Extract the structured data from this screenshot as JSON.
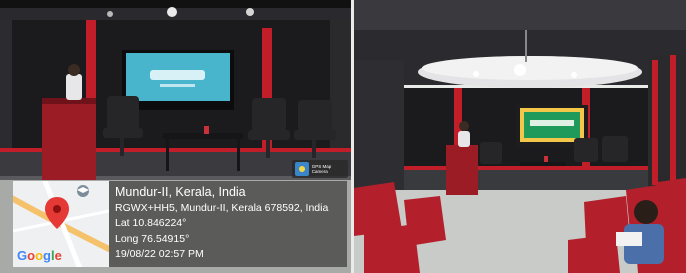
{
  "geotag": {
    "place": "Mundur-II, Kerala, India",
    "address": "RGWX+HH5, Mundur-II, Kerala 678592, India",
    "latitude": "Lat 10.846224°",
    "longitude": "Long 76.54915°",
    "timestamp": "19/08/22 02:57 PM"
  },
  "map": {
    "brand": "Google",
    "brand_colors": [
      "#4285F4",
      "#EA4335",
      "#FBBC05",
      "#4285F4",
      "#34A853",
      "#EA4335"
    ],
    "pin_color": "#e53935"
  },
  "camera_app": {
    "label": "GPS Map Camera",
    "icon": "camera-app-icon"
  },
  "colors": {
    "wall_red": "#c21e2a",
    "wall_black": "#1a1a1c",
    "seat_red": "#b3202c"
  }
}
